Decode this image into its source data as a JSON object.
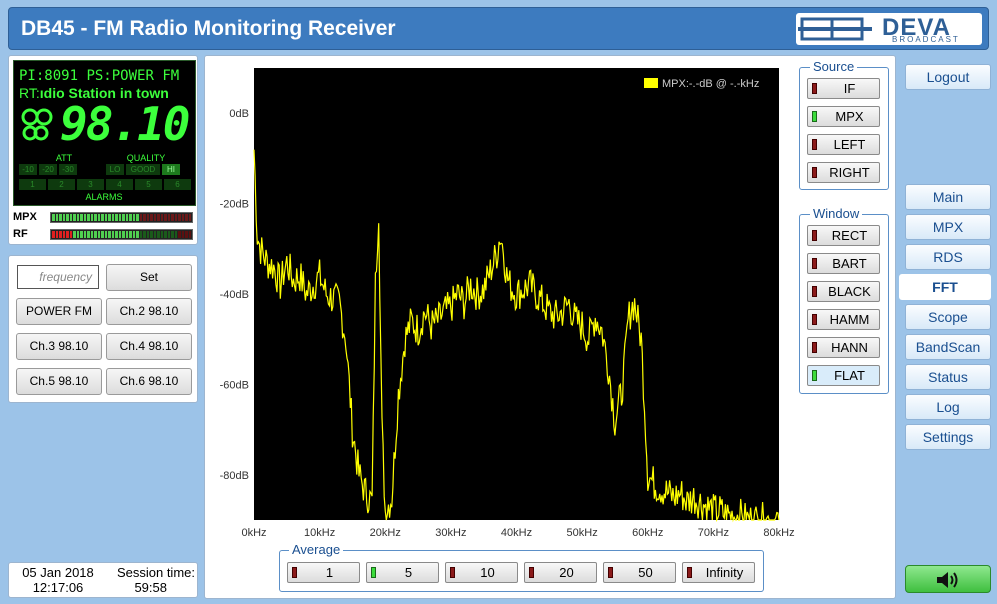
{
  "header": {
    "title": "DB45 - FM Radio Monitoring Receiver",
    "logo_text": "DEVA",
    "logo_sub": "BROADCAST"
  },
  "lcd": {
    "pi_label": "PI:",
    "pi_value": "8091",
    "ps_label": "PS:",
    "ps_value": "POWER FM",
    "rt_label": "RT:",
    "rt_value": "ıdio Station in town",
    "frequency": "98.10",
    "att_label": "ATT",
    "quality_label": "QUALITY",
    "alarms_label": "ALARMS",
    "att_cells": [
      "-10",
      "-20",
      "-30"
    ],
    "quality_cells": [
      "LO",
      "GOOD",
      "HI"
    ],
    "alarm_cells": [
      "1",
      "2",
      "3",
      "4",
      "5",
      "6"
    ]
  },
  "meters": {
    "mpx_label": "MPX",
    "rf_label": "RF",
    "mpx_level": 0.62,
    "rf_level": 0.62
  },
  "tuner": {
    "frequency_placeholder": "frequency",
    "set_label": "Set",
    "presets": [
      "POWER FM",
      "Ch.2 98.10",
      "Ch.3 98.10",
      "Ch.4 98.10",
      "Ch.5 98.10",
      "Ch.6 98.10"
    ]
  },
  "status": {
    "date": "05 Jan 2018",
    "time": "12:17:06",
    "session_label": "Session time:",
    "session_value": "59:58"
  },
  "source": {
    "title": "Source",
    "items": [
      {
        "label": "IF",
        "on": false
      },
      {
        "label": "MPX",
        "on": true
      },
      {
        "label": "LEFT",
        "on": false
      },
      {
        "label": "RIGHT",
        "on": false
      }
    ]
  },
  "window": {
    "title": "Window",
    "items": [
      {
        "label": "RECT",
        "on": false
      },
      {
        "label": "BART",
        "on": false
      },
      {
        "label": "BLACK",
        "on": false
      },
      {
        "label": "HAMM",
        "on": false
      },
      {
        "label": "HANN",
        "on": false
      },
      {
        "label": "FLAT",
        "on": true
      }
    ]
  },
  "average": {
    "title": "Average",
    "items": [
      {
        "label": "1",
        "on": false
      },
      {
        "label": "5",
        "on": true
      },
      {
        "label": "10",
        "on": false
      },
      {
        "label": "20",
        "on": false
      },
      {
        "label": "50",
        "on": false
      },
      {
        "label": "Infinity",
        "on": false
      }
    ]
  },
  "nav": {
    "logout": "Logout",
    "items": [
      {
        "label": "Main",
        "active": false
      },
      {
        "label": "MPX",
        "active": false
      },
      {
        "label": "RDS",
        "active": false
      },
      {
        "label": "FFT",
        "active": true
      },
      {
        "label": "Scope",
        "active": false
      },
      {
        "label": "BandScan",
        "active": false
      },
      {
        "label": "Status",
        "active": false
      },
      {
        "label": "Log",
        "active": false
      },
      {
        "label": "Settings",
        "active": false
      }
    ]
  },
  "colors": {
    "accent": "#3d7bbf",
    "trace": "#ffff00",
    "lcd_green": "#3cff3c"
  },
  "chart_data": {
    "type": "line",
    "legend": "MPX:-.-dB @ -.-kHz",
    "xlim": [
      0,
      80
    ],
    "ylim": [
      -90,
      10
    ],
    "x_ticks": [
      "0kHz",
      "10kHz",
      "20kHz",
      "30kHz",
      "40kHz",
      "50kHz",
      "60kHz",
      "70kHz",
      "80kHz"
    ],
    "y_ticks": [
      "0dB",
      "-20dB",
      "-40dB",
      "-60dB",
      "-80dB"
    ],
    "y_tick_values": [
      0,
      -20,
      -40,
      -60,
      -80
    ],
    "series": [
      {
        "x": [
          0,
          0.5,
          1,
          2,
          3,
          4,
          5,
          6,
          7,
          8,
          9,
          10,
          11,
          12,
          13,
          14,
          15,
          16,
          17,
          18,
          18.5,
          19,
          19.5,
          20,
          21,
          22,
          23,
          24,
          25,
          26,
          27,
          28,
          29,
          30,
          31,
          32,
          33,
          34,
          35,
          36,
          37,
          37.5,
          38,
          38.5,
          39,
          40,
          41,
          42,
          43,
          44,
          45,
          46,
          47,
          48,
          49,
          50,
          51,
          52,
          53,
          54,
          55,
          56,
          56.5,
          57,
          57.5,
          58,
          58.5,
          59,
          59.5,
          60,
          61,
          62,
          63,
          64,
          65,
          66,
          67,
          68,
          69,
          70,
          71,
          72,
          73,
          74,
          75,
          76,
          77,
          78,
          79,
          80
        ],
        "y": [
          -8,
          -27,
          -30,
          -33,
          -34,
          -38,
          -33,
          -37,
          -36,
          -40,
          -38,
          -36,
          -40,
          -41,
          -42,
          -50,
          -70,
          -80,
          -84,
          -86,
          -38,
          -21,
          -70,
          -88,
          -85,
          -62,
          -50,
          -46,
          -48,
          -44,
          -47,
          -46,
          -44,
          -43,
          -40,
          -42,
          -38,
          -40,
          -39,
          -35,
          -31,
          -27,
          -30,
          -36,
          -38,
          -40,
          -39,
          -38,
          -40,
          -42,
          -44,
          -45,
          -44,
          -42,
          -46,
          -47,
          -50,
          -45,
          -48,
          -56,
          -68,
          -62,
          -55,
          -46,
          -43,
          -42,
          -46,
          -50,
          -64,
          -80,
          -82,
          -83,
          -84,
          -85,
          -84,
          -86,
          -85,
          -86,
          -87,
          -88,
          -88,
          -89,
          -89,
          -89,
          -90,
          -90,
          -90,
          -90,
          -90,
          -90
        ]
      }
    ]
  }
}
